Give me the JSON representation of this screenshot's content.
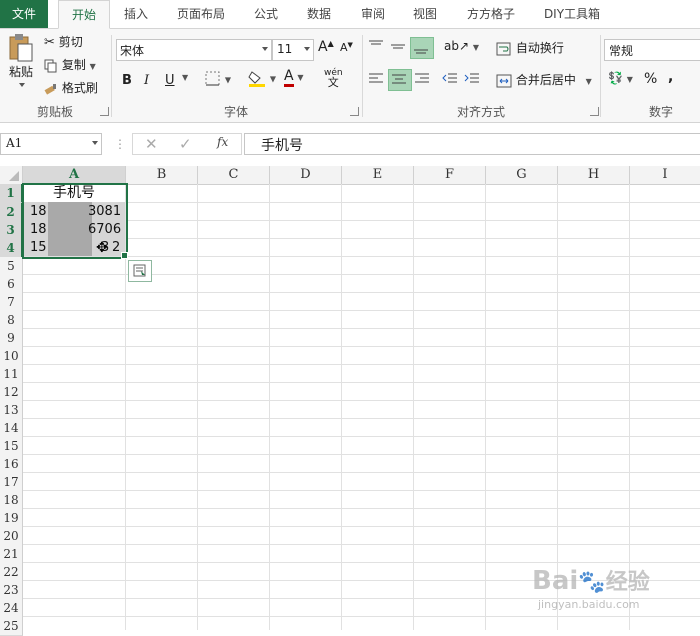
{
  "tabs": [
    "文件",
    "开始",
    "插入",
    "页面布局",
    "公式",
    "数据",
    "审阅",
    "视图",
    "方方格子",
    "DIY工具箱"
  ],
  "clipboard": {
    "paste": "粘贴",
    "cut": "剪切",
    "copy": "复制",
    "format_painter": "格式刷",
    "label": "剪贴板"
  },
  "font": {
    "name": "宋体",
    "size": "11",
    "bold": "B",
    "italic": "I",
    "underline": "U",
    "label": "字体",
    "phonetic": "wén"
  },
  "alignment": {
    "wrap_text": "自动换行",
    "merge_center": "合并后居中",
    "label": "对齐方式"
  },
  "number": {
    "format": "常规",
    "percent": "%",
    "comma": ",",
    "label": "数字"
  },
  "formula_bar": {
    "name_box": "A1",
    "fx": "fx",
    "content": "手机号"
  },
  "columns": [
    "A",
    "B",
    "C",
    "D",
    "E",
    "F",
    "G",
    "H",
    "I"
  ],
  "rows": [
    "1",
    "2",
    "3",
    "4",
    "5",
    "6",
    "7",
    "8",
    "9",
    "10",
    "11",
    "12",
    "13",
    "14",
    "15",
    "16",
    "17",
    "18",
    "19",
    "20",
    "21",
    "22",
    "23",
    "24",
    "25"
  ],
  "cells": {
    "A1": "手机号",
    "A2_prefix": "18",
    "A2_suffix": "3081",
    "A3_prefix": "18",
    "A3_suffix": "6706",
    "A4_prefix": "15",
    "A4_suffix": "3",
    "A4_end": "2"
  },
  "watermark": {
    "brand": "Bai",
    "brand_cn": "经验",
    "url": "jingyan.baidu.com"
  },
  "colors": {
    "excel_green": "#217346",
    "selection_fill": "#a9a9a9",
    "ribbon_bg": "#f7f7f7"
  }
}
